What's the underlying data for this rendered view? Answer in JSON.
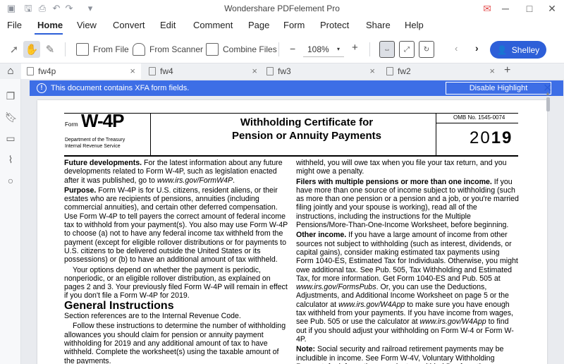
{
  "app": {
    "title": "Wondershare PDFelement Pro"
  },
  "menu": [
    "File",
    "Home",
    "View",
    "Convert",
    "Edit",
    "Comment",
    "Page",
    "Form",
    "Protect",
    "Share",
    "Help"
  ],
  "toolbar": {
    "from_file": "From File",
    "from_scanner": "From Scanner",
    "combine_files": "Combine Files",
    "zoom": "108%",
    "zoom_minus": "−",
    "zoom_plus": "+",
    "user": "Shelley"
  },
  "tabs": [
    "fw4p",
    "fw4",
    "fw3",
    "fw2"
  ],
  "xfa": {
    "message": "This document contains XFA form fields.",
    "disable": "Disable Highlight"
  },
  "form": {
    "form_label": "Form",
    "form_number": "W-4P",
    "dept_line1": "Department of the Treasury",
    "dept_line2": "Internal Revenue Service",
    "title_line1": "Withholding Certificate for",
    "title_line2": "Pension or Annuity Payments",
    "omb": "OMB No. 1545-0074",
    "year_prefix": "20",
    "year_suffix": "19"
  },
  "left_col": {
    "future_head": "Future developments.",
    "future_text": " For the latest information about any future developments related to Form W-4P, such as legislation enacted after it was published, go to ",
    "future_url": "www.irs.gov/FormW4P",
    "future_end": ".",
    "purpose_head": "Purpose.",
    "purpose_text": " Form W-4P is for U.S. citizens, resident aliens, or their estates who are recipients of pensions, annuities (including commercial annuities), and certain other deferred compensation. Use Form W-4P to tell payers the correct amount of federal income tax to withhold from your payment(s). You also may use Form W-4P to choose (a) not to have any federal income tax withheld from the payment (except for eligible rollover distributions or for payments to U.S. citizens to be delivered outside the United States or its possessions) or (b) to have an additional amount of tax withheld.",
    "options_text": "Your options depend on whether the payment is periodic, nonperiodic, or an eligible rollover distribution, as explained on pages 2 and 3. Your previously filed Form W-4P will remain in effect if you don't file a Form W-4P for 2019.",
    "gi_heading": "General Instructions",
    "section_ref": "Section references are to the Internal Revenue Code.",
    "follow_text": "Follow these instructions to determine the number of withholding allowances you should claim for pension or annuity payment withholding for 2019 and any additional amount of tax to have withheld. Complete the worksheet(s) using the taxable amount of the payments."
  },
  "right_col": {
    "withheld_text": "withheld, you will owe tax when you file your tax return, and you might owe a penalty.",
    "filers_head": "Filers with multiple pensions or more than one income.",
    "filers_text": " If you have more than one source of income subject to withholding (such as more than one pension or a pension and a job, or you're married filing jointly and your spouse is working), read all of the instructions, including the instructions for the Multiple Pensions/More-Than-One-Income Worksheet, before beginning.",
    "other_head": "Other income.",
    "other_text1": " If you have a large amount of income from other sources not subject to withholding (such as interest, dividends, or capital gains), consider making estimated tax payments using Form 1040-ES, Estimated Tax for Individuals. Otherwise, you might owe additional tax. See Pub. 505, Tax Withholding and Estimated Tax, for more information. Get Form 1040-ES and Pub. 505 at ",
    "other_url1": "www.irs.gov/FormsPubs",
    "other_text2": ". Or, you can use the Deductions, Adjustments, and Additional Income Worksheet on page 5 or the calculator at ",
    "other_url2": "www.irs.gov/W4App",
    "other_text3": " to make sure you have enough tax withheld from your payments. If you have income from wages, see Pub. 505 or use the calculator at ",
    "other_url3": "www.irs.gov/W4App",
    "other_text4": " to find out if you should adjust your withholding on Form W-4 or Form W-4P.",
    "note_head": "Note:",
    "note_text": " Social security and railroad retirement payments may be includible in income. See Form W-4V, Voluntary Withholding Request, for information on voluntary withholding from these"
  }
}
